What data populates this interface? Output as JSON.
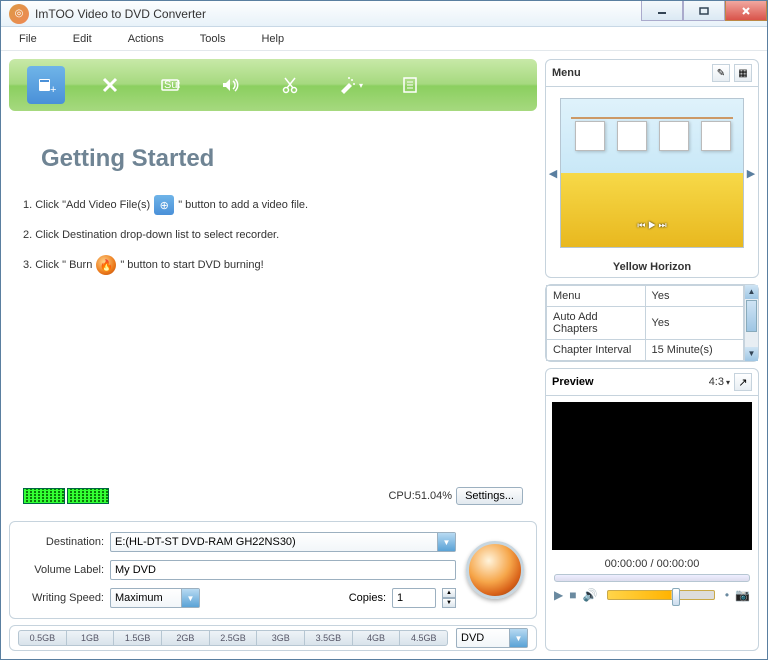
{
  "title": "ImTOO Video to DVD Converter",
  "menubar": [
    "File",
    "Edit",
    "Actions",
    "Tools",
    "Help"
  ],
  "gettingStarted": {
    "heading": "Getting Started",
    "step1a": "1. Click \"Add Video File(s)",
    "step1b": "\" button to add a video file.",
    "step2": "2. Click Destination drop-down list to select recorder.",
    "step3a": "3. Click \" Burn",
    "step3b": "\" button to start DVD burning!"
  },
  "cpu": {
    "label": "CPU:",
    "value": "51.04%",
    "settings": "Settings..."
  },
  "form": {
    "destinationLabel": "Destination:",
    "destinationValue": "E:(HL-DT-ST DVD-RAM GH22NS30)",
    "volumeLabel": "Volume Label:",
    "volumeValue": "My DVD",
    "speedLabel": "Writing Speed:",
    "speedValue": "Maximum",
    "copiesLabel": "Copies:",
    "copiesValue": "1"
  },
  "capacity": {
    "ticks": [
      "0.5GB",
      "1GB",
      "1.5GB",
      "2GB",
      "2.5GB",
      "3GB",
      "3.5GB",
      "4GB",
      "4.5GB"
    ],
    "disc": "DVD"
  },
  "menuPanel": {
    "title": "Menu",
    "themeName": "Yellow Horizon"
  },
  "props": [
    {
      "k": "Menu",
      "v": "Yes"
    },
    {
      "k": "Auto Add Chapters",
      "v": "Yes"
    },
    {
      "k": "Chapter Interval",
      "v": "15 Minute(s)"
    }
  ],
  "preview": {
    "title": "Preview",
    "aspect": "4:3",
    "time": "00:00:00 / 00:00:00"
  }
}
